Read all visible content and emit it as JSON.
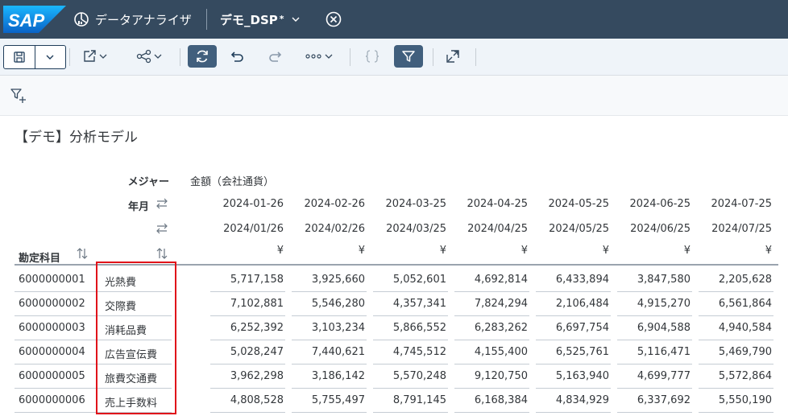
{
  "shell": {
    "logo_text": "SAP",
    "app_title": "データアナライザ",
    "story_name": "デモ_DSP",
    "dirty_mark": "*"
  },
  "icons": [
    "save-icon",
    "chevron-down-icon",
    "export-icon",
    "share-icon",
    "refresh-icon",
    "undo-icon",
    "redo-icon",
    "more-icon",
    "braces-icon",
    "filter-icon",
    "fullscreen-icon",
    "add-filter-icon",
    "swap-icon",
    "sort-icon",
    "close-circle-icon",
    "analyzer-icon"
  ],
  "page_title": "【デモ】分析モデル",
  "table": {
    "measure_label": "メジャー",
    "measure_value": "金額（会社通貨）",
    "yearmonth_label": "年月",
    "account_label": "勘定科目",
    "columns": [
      {
        "date1": "2024-01-26",
        "date2": "2024/01/26",
        "currency": "¥"
      },
      {
        "date1": "2024-02-26",
        "date2": "2024/02/26",
        "currency": "¥"
      },
      {
        "date1": "2024-03-25",
        "date2": "2024/03/25",
        "currency": "¥"
      },
      {
        "date1": "2024-04-25",
        "date2": "2024/04/25",
        "currency": "¥"
      },
      {
        "date1": "2024-05-25",
        "date2": "2024/05/25",
        "currency": "¥"
      },
      {
        "date1": "2024-06-25",
        "date2": "2024/06/25",
        "currency": "¥"
      },
      {
        "date1": "2024-07-25",
        "date2": "2024/07/25",
        "currency": "¥"
      }
    ],
    "rows": [
      {
        "id": "6000000001",
        "name": "光熱費",
        "values": [
          "5,717,158",
          "3,925,660",
          "5,052,601",
          "4,692,814",
          "6,433,894",
          "3,847,580",
          "2,205,628"
        ]
      },
      {
        "id": "6000000002",
        "name": "交際費",
        "values": [
          "7,102,881",
          "5,546,280",
          "4,357,341",
          "7,824,294",
          "2,106,484",
          "4,915,270",
          "6,561,864"
        ]
      },
      {
        "id": "6000000003",
        "name": "消耗品費",
        "values": [
          "6,252,392",
          "3,103,234",
          "5,866,552",
          "6,283,262",
          "6,697,754",
          "6,904,588",
          "4,940,584"
        ]
      },
      {
        "id": "6000000004",
        "name": "広告宣伝費",
        "values": [
          "5,028,247",
          "7,440,621",
          "4,745,512",
          "4,155,400",
          "6,525,761",
          "5,116,471",
          "5,469,790"
        ]
      },
      {
        "id": "6000000005",
        "name": "旅費交通費",
        "values": [
          "3,962,298",
          "3,186,142",
          "5,570,248",
          "9,120,750",
          "5,163,940",
          "4,699,777",
          "5,572,864"
        ]
      },
      {
        "id": "6000000006",
        "name": "売上手数料",
        "values": [
          "4,808,528",
          "5,755,497",
          "8,791,145",
          "6,168,384",
          "4,834,929",
          "6,337,692",
          "5,550,190"
        ]
      }
    ]
  },
  "colors": {
    "shell_bg": "#354a5f",
    "toolbar_bg": "#eff4f9",
    "active_btn": "#415f7d",
    "highlight": "#e0131a"
  }
}
